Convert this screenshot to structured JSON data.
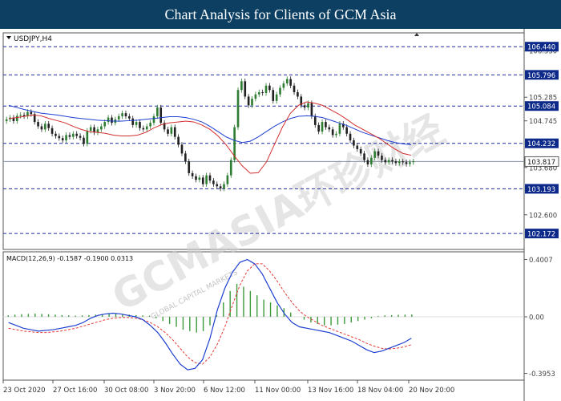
{
  "banner": {
    "title": "Chart Analysis for Clients of GCM Asia"
  },
  "watermark": "GCMASIA环珍财经",
  "watermark_sub": "GLOBAL CAPITAL MARKETS",
  "colors": {
    "banner": "#0d3f63",
    "bull": "#2e7d32",
    "bear": "#212121",
    "ma_fast": "#d32f2f",
    "ma_slow": "#1e3fd0",
    "level_line": "#1f2a9c",
    "macd_hist": "#3c9b3c",
    "macd_line": "#1e3fd0",
    "macd_signal": "#e53935",
    "label_bg": "#0d2a8a"
  },
  "chart_data": [
    {
      "type": "candlestick",
      "title": "USDJPY,H4",
      "ylim": [
        101.9,
        106.7
      ],
      "y_ticks": [
        106.35,
        105.285,
        104.745,
        103.68,
        102.6
      ],
      "x_ticks": [
        "23 Oct 2020",
        "27 Oct 16:00",
        "30 Oct 08:00",
        "3 Nov 20:00",
        "6 Nov 12:00",
        "11 Nov 00:00",
        "13 Nov 16:00",
        "18 Nov 04:00",
        "20 Nov 20:00"
      ],
      "levels": [
        {
          "label": "106.440",
          "value": 106.44
        },
        {
          "label": "105.796",
          "value": 105.796
        },
        {
          "label": "105.084",
          "value": 105.084
        },
        {
          "label": "104.232",
          "value": 104.232
        },
        {
          "label": "103.193",
          "value": 103.193
        },
        {
          "label": "102.172",
          "value": 102.172
        }
      ],
      "current_price": {
        "label": "103.817",
        "value": 103.817
      },
      "candles_close": [
        104.78,
        104.82,
        104.74,
        104.86,
        104.88,
        104.85,
        104.95,
        104.9,
        104.72,
        104.62,
        104.55,
        104.68,
        104.58,
        104.45,
        104.4,
        104.35,
        104.3,
        104.42,
        104.38,
        104.45,
        104.4,
        104.36,
        104.22,
        104.52,
        104.6,
        104.48,
        104.55,
        104.62,
        104.72,
        104.82,
        104.7,
        104.78,
        104.85,
        104.92,
        104.85,
        104.8,
        104.65,
        104.72,
        104.58,
        104.55,
        104.62,
        104.7,
        104.85,
        105.05,
        104.7,
        104.55,
        104.45,
        104.6,
        104.38,
        104.2,
        104.0,
        103.82,
        103.55,
        103.48,
        103.4,
        103.45,
        103.3,
        103.5,
        103.38,
        103.3,
        103.25,
        103.2,
        103.3,
        103.5,
        103.85,
        104.6,
        105.45,
        105.65,
        105.3,
        105.1,
        105.25,
        105.35,
        105.4,
        105.38,
        105.55,
        105.45,
        105.2,
        105.35,
        105.5,
        105.6,
        105.7,
        105.55,
        105.4,
        105.3,
        105.1,
        105.05,
        105.15,
        104.85,
        104.65,
        104.5,
        104.72,
        104.6,
        104.55,
        104.42,
        104.45,
        104.68,
        104.6,
        104.45,
        104.3,
        104.18,
        104.1,
        104.0,
        103.85,
        103.75,
        103.9,
        104.05,
        103.95,
        103.85,
        103.8,
        103.85,
        103.82,
        103.78,
        103.82,
        103.8,
        103.76,
        103.8,
        103.82
      ],
      "ma_fast": [
        104.8,
        104.82,
        104.85,
        104.88,
        104.86,
        104.8,
        104.75,
        104.7,
        104.62,
        104.55,
        104.5,
        104.48,
        104.46,
        104.42,
        104.4,
        104.4,
        104.42,
        104.48,
        104.58,
        104.66,
        104.7,
        104.72,
        104.74,
        104.72,
        104.65,
        104.55,
        104.4,
        104.2,
        103.95,
        103.72,
        103.55,
        103.56,
        103.8,
        104.2,
        104.6,
        104.92,
        105.1,
        105.18,
        105.15,
        105.1,
        105.0,
        104.9,
        104.78,
        104.65,
        104.55,
        104.45,
        104.35,
        104.22,
        104.1,
        104.0,
        103.96
      ],
      "ma_slow": [
        105.1,
        105.05,
        105.0,
        104.96,
        104.92,
        104.9,
        104.88,
        104.85,
        104.82,
        104.8,
        104.78,
        104.76,
        104.75,
        104.74,
        104.74,
        104.75,
        104.76,
        104.78,
        104.8,
        104.82,
        104.84,
        104.84,
        104.82,
        104.78,
        104.72,
        104.62,
        104.5,
        104.38,
        104.3,
        104.25,
        104.28,
        104.38,
        104.5,
        104.62,
        104.72,
        104.8,
        104.85,
        104.86,
        104.85,
        104.82,
        104.76,
        104.7,
        104.64,
        104.56,
        104.48,
        104.42,
        104.36,
        104.3,
        104.25,
        104.22,
        104.2
      ]
    },
    {
      "type": "macd",
      "title": "MACD(12,26,9) -0.1587 -0.1900 0.0313",
      "ylim": [
        -0.42,
        0.42
      ],
      "y_ticks": [
        {
          "label": "0.4007",
          "value": 0.4007
        },
        {
          "label": "0.00",
          "value": 0.0
        },
        {
          "label": "-0.3953",
          "value": -0.3953
        }
      ],
      "histogram": [
        0.01,
        0.015,
        0.018,
        0.02,
        0.022,
        0.02,
        0.018,
        0.015,
        0.012,
        0.01,
        0.008,
        0.01,
        0.012,
        0.015,
        0.018,
        0.02,
        0.02,
        0.018,
        0.015,
        0.012,
        0.01,
        0.008,
        -0.01,
        -0.03,
        -0.05,
        -0.07,
        -0.09,
        -0.1,
        -0.11,
        -0.1,
        -0.06,
        0.01,
        0.1,
        0.18,
        0.23,
        0.21,
        0.18,
        0.15,
        0.12,
        0.1,
        0.08,
        0.06,
        0.03,
        0.0,
        -0.02,
        -0.04,
        -0.05,
        -0.06,
        -0.06,
        -0.055,
        -0.05,
        -0.04,
        -0.03,
        -0.02,
        -0.01,
        0.005,
        0.01,
        0.012,
        0.014,
        0.015,
        0.016
      ],
      "macd_line": [
        -0.04,
        -0.06,
        -0.08,
        -0.09,
        -0.1,
        -0.095,
        -0.09,
        -0.08,
        -0.07,
        -0.06,
        -0.04,
        -0.01,
        0.01,
        0.02,
        0.025,
        0.02,
        0.01,
        0.0,
        -0.02,
        -0.06,
        -0.11,
        -0.18,
        -0.26,
        -0.33,
        -0.37,
        -0.36,
        -0.3,
        -0.15,
        0.05,
        0.2,
        0.31,
        0.38,
        0.4,
        0.37,
        0.3,
        0.2,
        0.1,
        0.02,
        -0.04,
        -0.07,
        -0.08,
        -0.09,
        -0.1,
        -0.11,
        -0.13,
        -0.15,
        -0.17,
        -0.2,
        -0.23,
        -0.25,
        -0.24,
        -0.22,
        -0.2,
        -0.18,
        -0.15
      ],
      "signal_line": [
        -0.08,
        -0.09,
        -0.1,
        -0.105,
        -0.11,
        -0.11,
        -0.105,
        -0.1,
        -0.09,
        -0.08,
        -0.065,
        -0.05,
        -0.035,
        -0.02,
        -0.01,
        -0.005,
        -0.005,
        -0.01,
        -0.02,
        -0.04,
        -0.07,
        -0.11,
        -0.16,
        -0.22,
        -0.28,
        -0.32,
        -0.33,
        -0.28,
        -0.19,
        -0.07,
        0.08,
        0.22,
        0.32,
        0.37,
        0.37,
        0.32,
        0.25,
        0.17,
        0.1,
        0.04,
        0.0,
        -0.03,
        -0.06,
        -0.08,
        -0.1,
        -0.12,
        -0.14,
        -0.16,
        -0.185,
        -0.205,
        -0.22,
        -0.225,
        -0.22,
        -0.21,
        -0.195
      ]
    }
  ]
}
